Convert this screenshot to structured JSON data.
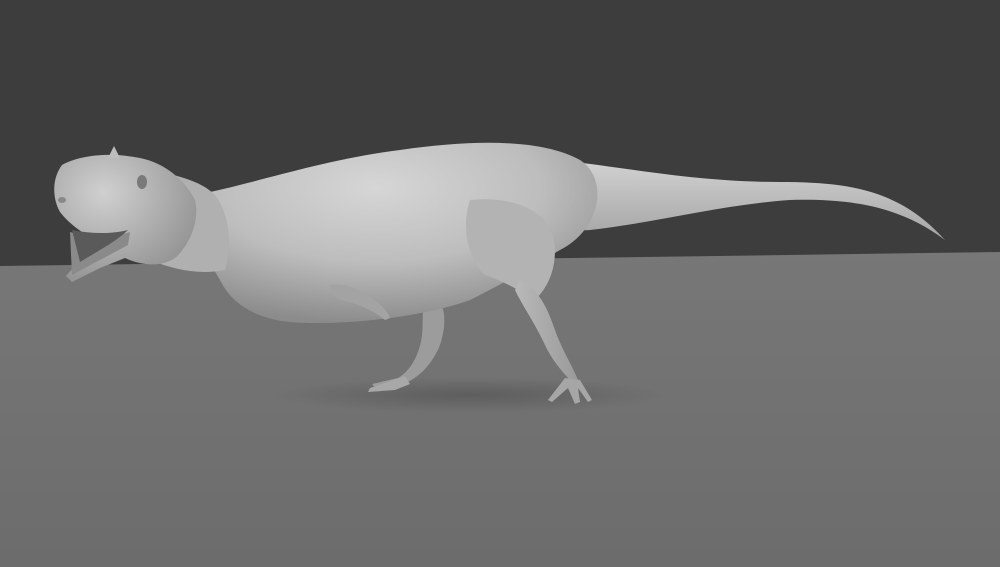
{
  "scene": {
    "subject": "dinosaur-sculpt",
    "colors": {
      "background": "#3d3d3d",
      "ground": "#717171",
      "ground_far": "#757575",
      "model_light": "#cfcfcf",
      "model_mid": "#a9a9a9",
      "model_shadow": "#6e6e6e",
      "shadow": "#5e5e5e"
    }
  }
}
